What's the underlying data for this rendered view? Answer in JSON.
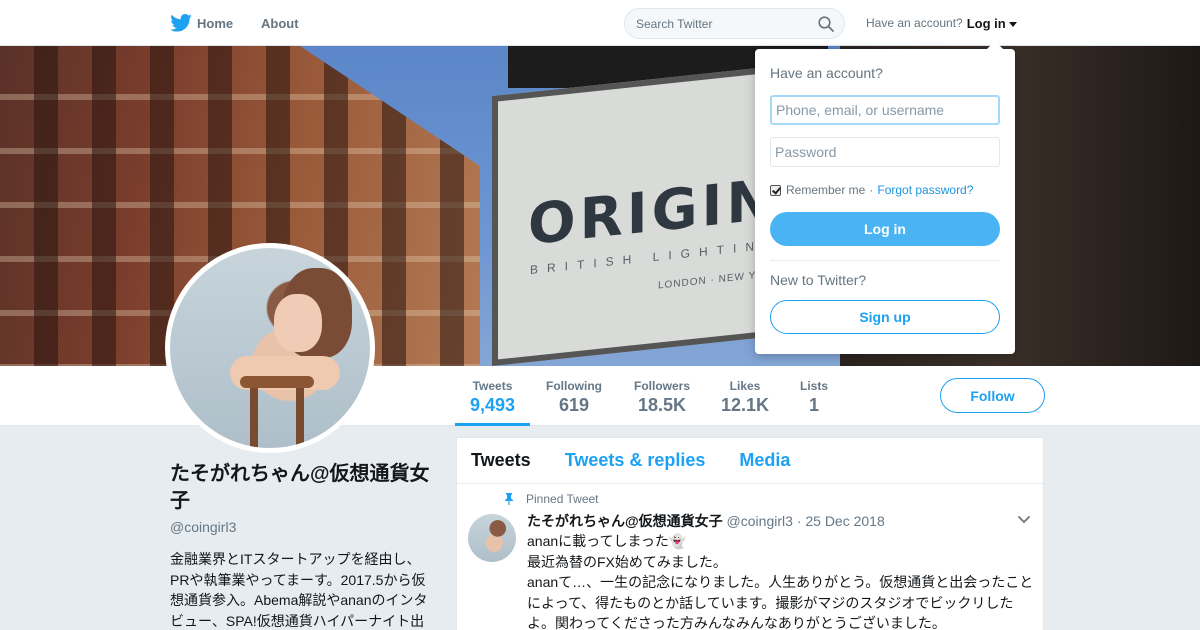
{
  "nav": {
    "home_label": "Home",
    "about_label": "About",
    "search_placeholder": "Search Twitter",
    "account_prompt": "Have an account?",
    "login_label": "Log in",
    "icons": {
      "home": "twitter-bird-icon",
      "search": "search-icon",
      "dropdown": "caret-down-icon"
    }
  },
  "banner": {
    "sign_text": "ORIGINA",
    "sign_subtext": "BRITISH LIGHTING M",
    "sign_subtext2": "LONDON · NEW YORK"
  },
  "profile": {
    "name": "たそがれちゃん@仮想通貨女子",
    "handle": "@coingirl3",
    "bio": "金融業界とITスタートアップを経由し、PRや執筆業やってまーす。2017.5から仮想通貨参入。Abema解説やananのインタビュー、SPA!仮想通貨ハイパーナイト出"
  },
  "stats": [
    {
      "label": "Tweets",
      "value": "9,493",
      "active": true
    },
    {
      "label": "Following",
      "value": "619",
      "active": false
    },
    {
      "label": "Followers",
      "value": "18.5K",
      "active": false
    },
    {
      "label": "Likes",
      "value": "12.1K",
      "active": false
    },
    {
      "label": "Lists",
      "value": "1",
      "active": false
    }
  ],
  "follow_label": "Follow",
  "timeline": {
    "tabs": [
      "Tweets",
      "Tweets & replies",
      "Media"
    ],
    "active_tab": "Tweets",
    "pinned_label": "Pinned Tweet",
    "tweet": {
      "fullname": "たそがれちゃん@仮想通貨女子",
      "handle": "@coingirl3",
      "date": "25 Dec 2018",
      "line1": "ananに載ってしまった👻",
      "line2": "最近為替のFX始めてみました。",
      "line3": "ananて…、一生の記念になりました。人生ありがとう。仮想通貨と出会ったことによって、得たものとか話しています。撮影がマジのスタジオでビックリしたよ。関わってくださった方みんなみんなありがとうございました。"
    }
  },
  "login_dropdown": {
    "title": "Have an account?",
    "username_placeholder": "Phone, email, or username",
    "password_placeholder": "Password",
    "remember_label": "Remember me",
    "separator": "·",
    "forgot_label": "Forgot password?",
    "login_button": "Log in",
    "new_prompt": "New to Twitter?",
    "signup_button": "Sign up"
  },
  "colors": {
    "brand": "#1da1f2",
    "login_button": "#4ab3f4",
    "background": "#e6ecf0",
    "muted": "#657786"
  }
}
